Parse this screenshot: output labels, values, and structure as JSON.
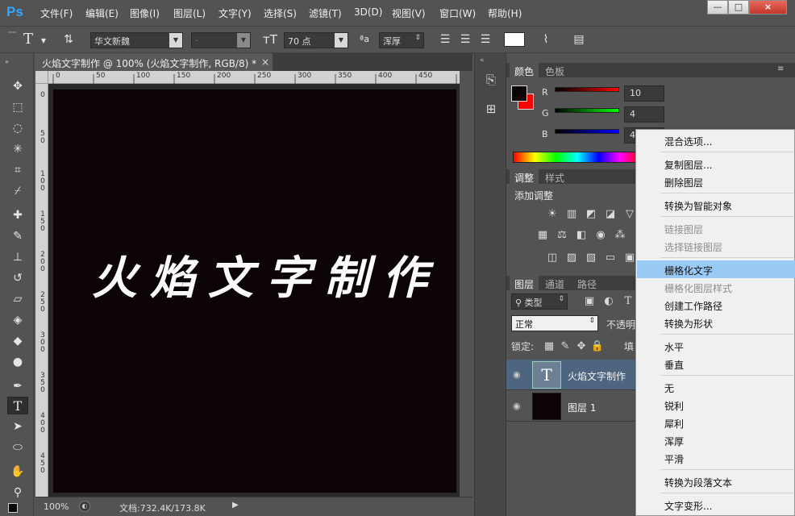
{
  "app": {
    "logo": "Ps"
  },
  "menu": [
    "文件(F)",
    "编辑(E)",
    "图像(I)",
    "图层(L)",
    "文字(Y)",
    "选择(S)",
    "滤镜(T)",
    "3D(D)",
    "视图(V)",
    "窗口(W)",
    "帮助(H)"
  ],
  "window_controls": {
    "minimize": "—",
    "maximize": "□",
    "close": "×"
  },
  "options": {
    "font_family": "华文新魏",
    "font_style": "-",
    "font_size": "70 点",
    "aa_label": "ªa",
    "antialias": "浑厚"
  },
  "document": {
    "tab_title": "火焰文字制作 @ 100% (火焰文字制作, RGB/8) *",
    "tab_close": "×",
    "canvas_text": "火焰文字制作",
    "ruler_h": [
      "0",
      "50",
      "100",
      "150",
      "200",
      "250",
      "300",
      "350",
      "400",
      "450"
    ],
    "ruler_v": [
      "0",
      "5\n0",
      "1\n0\n0",
      "1\n5\n0",
      "2\n0\n0",
      "2\n5\n0",
      "3\n0\n0",
      "3\n5\n0",
      "4\n0\n0",
      "4\n5\n0"
    ],
    "zoom": "100%",
    "doc_size": "文档:732.4K/173.8K"
  },
  "color_panel": {
    "tabs": [
      "颜色",
      "色板"
    ],
    "r_label": "R",
    "g_label": "G",
    "b_label": "B",
    "r": "10",
    "g": "4",
    "b": "4",
    "foreground": "#0a0404",
    "background": "#ff0000"
  },
  "adjust_panel": {
    "tabs": [
      "调整",
      "样式"
    ],
    "title": "添加调整"
  },
  "layers_panel": {
    "tabs": [
      "图层",
      "通道",
      "路径"
    ],
    "filter": "类型",
    "blend_mode": "正常",
    "opacity_label": "不透明",
    "lock_label": "锁定:",
    "fill_label": "填",
    "layers": [
      {
        "name": "火焰文字制作",
        "thumb": "T"
      },
      {
        "name": "图层 1",
        "thumb": ""
      }
    ]
  },
  "context_menu": {
    "items": [
      {
        "label": "混合选项..."
      },
      {
        "label": "复制图层..."
      },
      {
        "label": "删除图层"
      },
      {
        "label": "转换为智能对象"
      },
      {
        "label": "链接图层"
      },
      {
        "label": "选择链接图层"
      },
      {
        "label": "栅格化文字"
      },
      {
        "label": "栅格化图层样式"
      },
      {
        "label": "创建工作路径"
      },
      {
        "label": "转换为形状"
      },
      {
        "label": "水平"
      },
      {
        "label": "垂直"
      },
      {
        "label": "无"
      },
      {
        "label": "锐利"
      },
      {
        "label": "犀利"
      },
      {
        "label": "浑厚"
      },
      {
        "label": "平滑"
      },
      {
        "label": "转换为段落文本"
      },
      {
        "label": "文字变形..."
      }
    ]
  }
}
